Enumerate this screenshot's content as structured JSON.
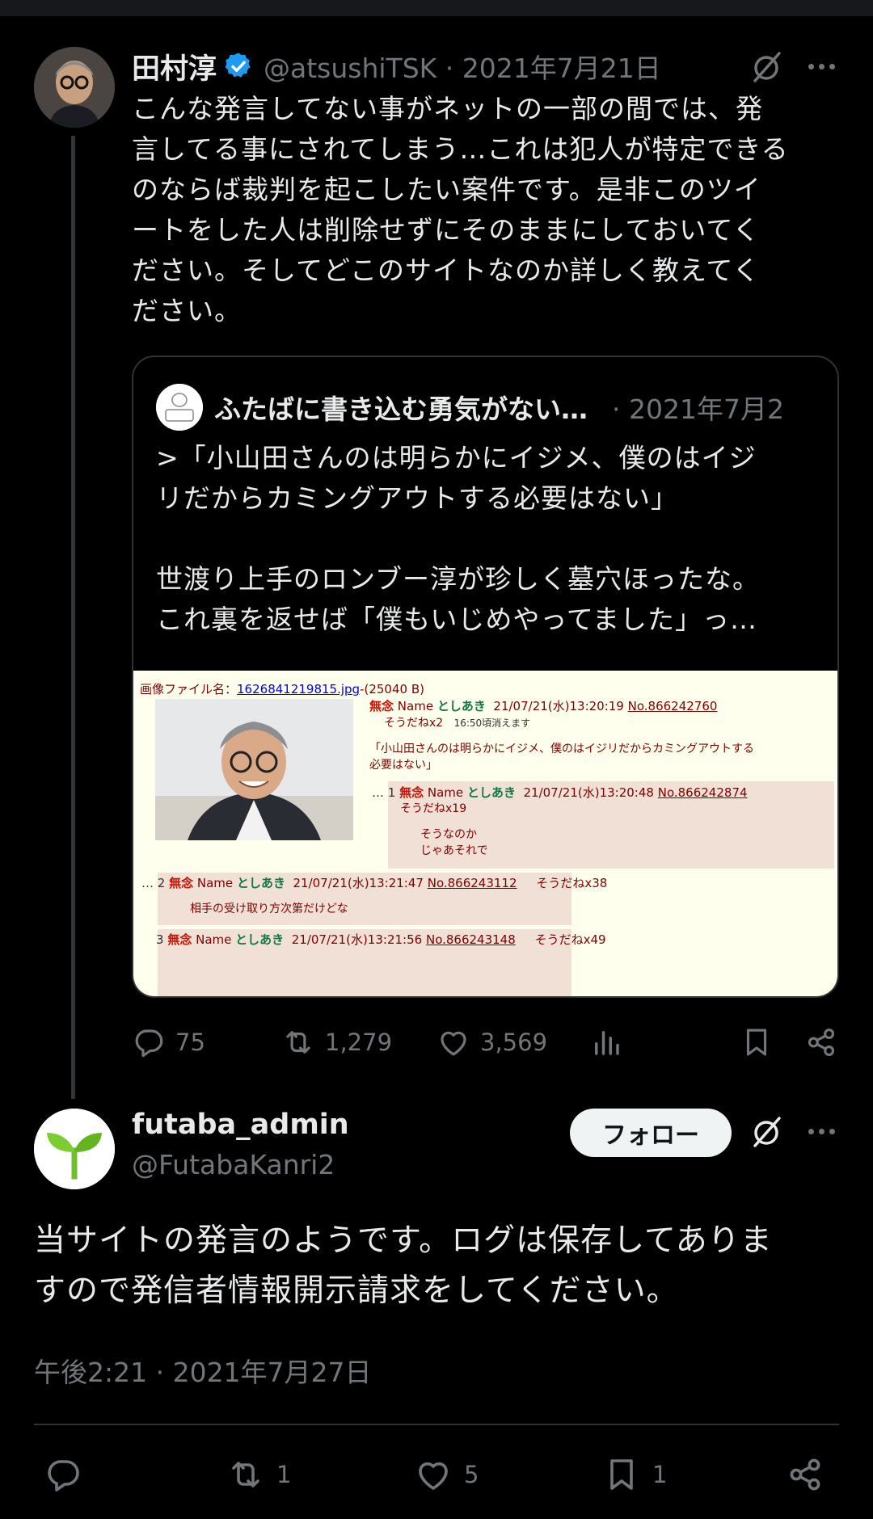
{
  "tweet1": {
    "name": "田村淳",
    "handle": "@atsushiTSK · 2021年7月21日",
    "text": "こんな発言してない事がネットの一部の間では、発\n言してる事にされてしまう…これは犯人が特定できる\nのならば裁判を起こしたい案件です。是非このツイ\nートをした人は削除せずにそのままにしておいてく\nださい。そしてどこのサイトなのか詳しく教えてく\nださい。",
    "replies": "75",
    "retweets": "1,279",
    "likes": "3,569"
  },
  "quote": {
    "name": "ふたばに書き込む勇気がない…",
    "date": "· 2021年7月2",
    "text": ">「小山田さんのは明らかにイジメ、僕のはイジ\nリだからカミングアウトする必要はない」\n\n世渡り上手のロンブー淳が珍しく墓穴ほったな。\nこれ裏を返せば「僕もいじめやってました」っ…",
    "image": {
      "file_label": "画像ファイル名：",
      "file_name": "1626841219815.jpg",
      "file_size": "-(25040 B)",
      "op_mu": "無念",
      "op_name_label": "Name",
      "op_name": "としあき",
      "op_date": "21/07/21(水)13:20:19",
      "op_no": "No.866242760",
      "op_sodane": "そうだねx2",
      "op_expire": "16:50頃消えます",
      "op_text1": "「小山田さんのは明らかにイジメ、僕のはイジリだからカミングアウトする",
      "op_text2": "必要はない」",
      "r1_prefix": "… 1",
      "r1_date": "21/07/21(水)13:20:48",
      "r1_no": "No.866242874",
      "r1_sodane": "そうだねx19",
      "r1_text1": "そうなのか",
      "r1_text2": "じゃあそれで",
      "r2_prefix": "… 2",
      "r2_date": "21/07/21(水)13:21:47",
      "r2_no": "No.866243112",
      "r2_sodane": "そうだねx38",
      "r2_text": "相手の受け取り方次第だけどな",
      "r3_prefix": "3",
      "r3_date": "21/07/21(水)13:21:56",
      "r3_no": "No.866243148",
      "r3_sodane": "そうだねx49"
    }
  },
  "tweet2": {
    "name": "futaba_admin",
    "handle": "@FutabaKanri2",
    "follow_label": "フォロー",
    "text": "当サイトの発言のようです。ログは保存してありま\nすので発信者情報開示請求をしてください。",
    "time": "午後2:21 · 2021年7月27日",
    "retweets": "1",
    "likes": "5",
    "bookmarks": "1"
  },
  "icons": [
    "verified-icon",
    "grok-icon",
    "more-icon",
    "reply-icon",
    "retweet-icon",
    "like-icon",
    "views-icon",
    "bookmark-icon",
    "share-icon"
  ],
  "colors": {
    "background": "#000000",
    "text": "#e7e9ea",
    "muted": "#71767b",
    "verified": "#1d9bf0",
    "border": "#2f3336"
  }
}
